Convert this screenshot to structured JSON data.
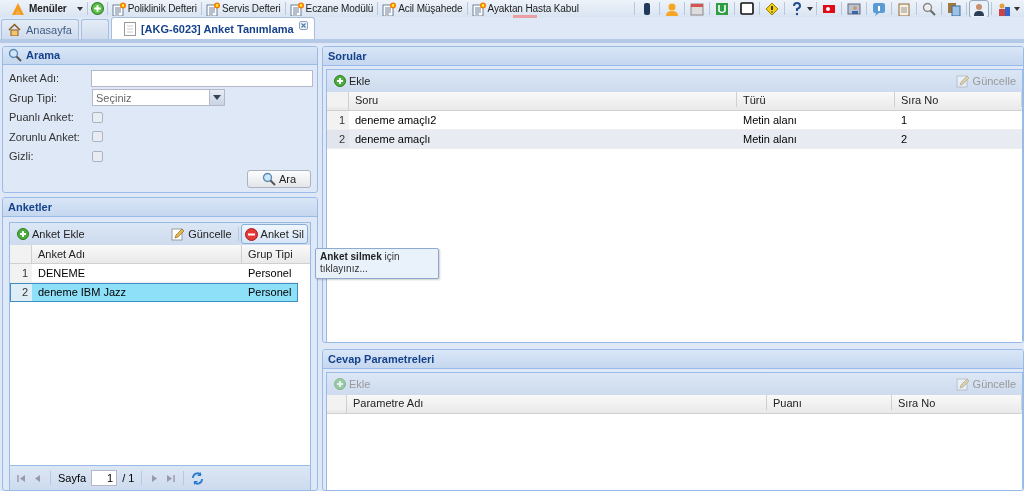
{
  "toolbar": {
    "menu_label": "Menüler",
    "modules": [
      "Poliklinik Defteri",
      "Servis Defteri",
      "Eczane Modülü",
      "Acil Müşahede",
      "Ayaktan Hasta Kabul"
    ]
  },
  "tabs": [
    {
      "kind": "home",
      "label": "Anasayfa",
      "selected": false
    },
    {
      "kind": "empty",
      "selected": false
    },
    {
      "kind": "page",
      "label": "[AKG-6023] Anket Tanımlama",
      "selected": true,
      "closable": true
    }
  ],
  "search": {
    "title": "Arama",
    "fields": [
      {
        "kind": "text",
        "label": "Anket Adı:"
      },
      {
        "kind": "select",
        "label": "Grup Tipi:",
        "placeholder": "Seçiniz"
      },
      {
        "kind": "checkbox",
        "label": "Puanlı Anket:",
        "checked": false
      },
      {
        "kind": "checkbox",
        "label": "Zorunlu Anket:",
        "checked": false
      },
      {
        "kind": "checkbox",
        "label": "Gizli:",
        "checked": false
      }
    ],
    "button": "Ara"
  },
  "surveys": {
    "title": "Anketler",
    "buttons": [
      {
        "kind": "add",
        "label": "Anket Ekle",
        "disabled": false,
        "hovered": false
      },
      {
        "kind": "edit",
        "label": "Güncelle",
        "disabled": false,
        "hovered": false
      },
      {
        "kind": "delete",
        "label": "Anket Sil",
        "disabled": false,
        "hovered": true
      }
    ],
    "columns": [
      "Anket Adı",
      "Grup Tipi"
    ],
    "rows": [
      {
        "number": "1",
        "cells": [
          "DENEME",
          "Personel"
        ],
        "selected": false
      },
      {
        "number": "2",
        "cells": [
          "deneme IBM Jazz",
          "Personel"
        ],
        "selected": true
      }
    ],
    "pager": {
      "label": "Sayfa",
      "page": "1",
      "total": "/ 1"
    }
  },
  "tooltip": {
    "text": "**Anket silmek** için tıklayınız..."
  },
  "questions": {
    "title": "Sorular",
    "buttons": [
      {
        "kind": "add",
        "label": "Ekle",
        "disabled": false,
        "hovered": false
      },
      {
        "kind": "edit",
        "label": "Güncelle",
        "disabled": true,
        "hovered": false
      }
    ],
    "columns": [
      "Soru",
      "Türü",
      "Sıra No"
    ],
    "rows": [
      {
        "number": "1",
        "cells": [
          "deneme amaçlı2",
          "Metin alanı",
          "1"
        ],
        "selected": false
      },
      {
        "number": "2",
        "cells": [
          "deneme amaçlı",
          "Metin alanı",
          "2"
        ],
        "selected": false
      }
    ]
  },
  "answers": {
    "title": "Cevap Parametreleri",
    "buttons": [
      {
        "kind": "add",
        "label": "Ekle",
        "disabled": true,
        "hovered": false
      },
      {
        "kind": "edit",
        "label": "Güncelle",
        "disabled": true,
        "hovered": false
      }
    ],
    "columns": [
      "Parametre Adı",
      "Puanı",
      "Sıra No"
    ]
  }
}
